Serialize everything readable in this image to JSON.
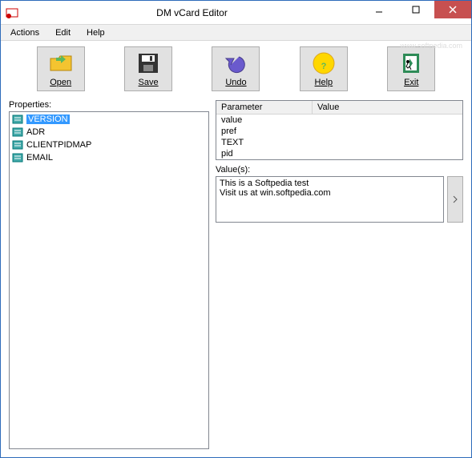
{
  "window": {
    "title": "DM vCard Editor"
  },
  "menubar": {
    "items": [
      "Actions",
      "Edit",
      "Help"
    ]
  },
  "toolbar": {
    "open": "Open",
    "save": "Save",
    "undo": "Undo",
    "help": "Help",
    "exit": "Exit"
  },
  "labels": {
    "properties": "Properties:",
    "values": "Value(s):",
    "col_parameter": "Parameter",
    "col_value": "Value"
  },
  "properties": {
    "items": [
      {
        "name": "VERSION",
        "selected": true
      },
      {
        "name": "ADR",
        "selected": false
      },
      {
        "name": "CLIENTPIDMAP",
        "selected": false
      },
      {
        "name": "EMAIL",
        "selected": false
      }
    ]
  },
  "parameters": {
    "rows": [
      {
        "param": "value",
        "val": ""
      },
      {
        "param": "pref",
        "val": ""
      },
      {
        "param": "TEXT",
        "val": ""
      },
      {
        "param": "pid",
        "val": ""
      }
    ]
  },
  "values_text": "This is a Softpedia test\nVisit us at win.softpedia.com",
  "watermark": "www.softpedia.com"
}
